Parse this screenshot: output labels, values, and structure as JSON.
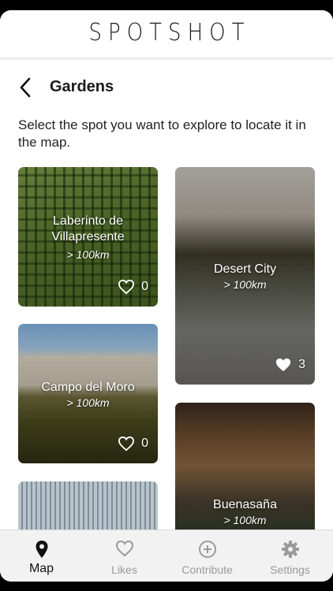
{
  "app": {
    "logo": "SPOTSHOT"
  },
  "page": {
    "title": "Gardens",
    "description": "Select the spot you want to explore to locate it in the map."
  },
  "spots": [
    {
      "name": "Laberinto de Villapresente",
      "distance": "> 100km",
      "likes": "0"
    },
    {
      "name": "Desert City",
      "distance": "> 100km",
      "likes": "3"
    },
    {
      "name": "Campo del Moro",
      "distance": "> 100km",
      "likes": "0"
    },
    {
      "name": "Buenasaña",
      "distance": "> 100km"
    }
  ],
  "tabs": [
    {
      "label": "Map",
      "icon": "map-pin-icon",
      "active": true
    },
    {
      "label": "Likes",
      "icon": "heart-icon"
    },
    {
      "label": "Contribute",
      "icon": "plus-circle-icon"
    },
    {
      "label": "Settings",
      "icon": "gear-icon"
    }
  ],
  "colors": {
    "active_tab": "#111111",
    "inactive_tab": "#9a9a9a",
    "tab_bar_bg": "#f2f2f2"
  }
}
